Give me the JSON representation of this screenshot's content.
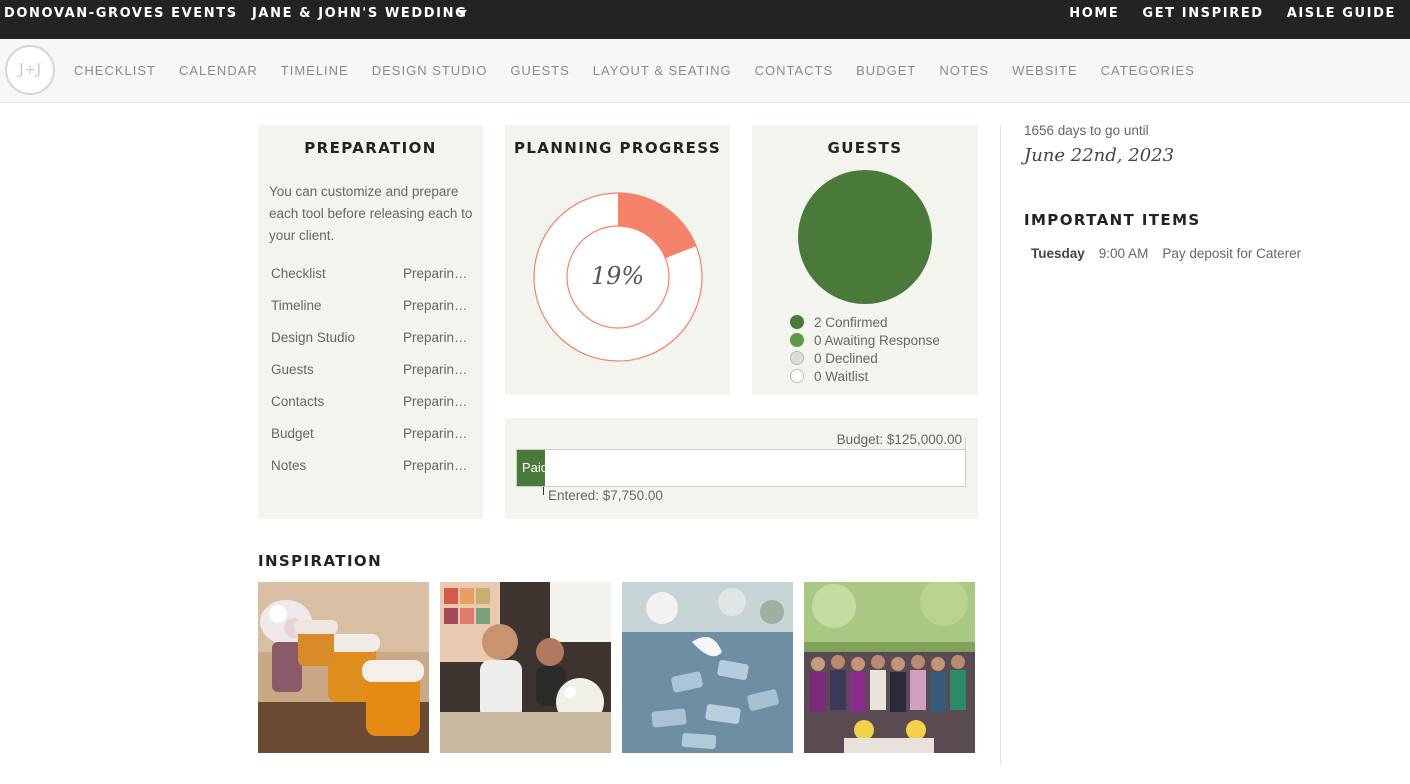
{
  "topbar": {
    "org": "DONOVAN-GROVES EVENTS",
    "separator": ">",
    "event": "JANE & JOHN'S WEDDING",
    "links": [
      "HOME",
      "GET INSPIRED",
      "AISLE GUIDE"
    ]
  },
  "subnav": {
    "avatar_text": "J+J",
    "items": [
      "CHECKLIST",
      "CALENDAR",
      "TIMELINE",
      "DESIGN STUDIO",
      "GUESTS",
      "LAYOUT & SEATING",
      "CONTACTS",
      "BUDGET",
      "NOTES",
      "WEBSITE",
      "CATEGORIES"
    ]
  },
  "preparation": {
    "title": "PREPARATION",
    "description": "You can customize and prepare each tool before releasing each to your client.",
    "tools": [
      {
        "name": "Checklist",
        "status": "Preparing..."
      },
      {
        "name": "Timeline",
        "status": "Preparing..."
      },
      {
        "name": "Design Studio",
        "status": "Preparing..."
      },
      {
        "name": "Guests",
        "status": "Preparing..."
      },
      {
        "name": "Contacts",
        "status": "Preparing..."
      },
      {
        "name": "Budget",
        "status": "Preparing..."
      },
      {
        "name": "Notes",
        "status": "Preparing..."
      }
    ]
  },
  "planning_progress": {
    "title": "PLANNING PROGRESS",
    "percent_label": "19%",
    "percent": 19,
    "accent_color": "#f4836a"
  },
  "guests": {
    "title": "GUESTS",
    "pie_color": "#4a7a3a",
    "legend": [
      {
        "label": "2 Confirmed",
        "color": "#4a7a3a"
      },
      {
        "label": "0 Awaiting Response",
        "color": "#5d9a45"
      },
      {
        "label": "0 Declined",
        "color": "#dcdcdc"
      },
      {
        "label": "0 Waitlist",
        "color": "#ffffff"
      }
    ]
  },
  "budget": {
    "total_label": "Budget: $125,000.00",
    "paid_label": "Paid",
    "entered_label": "Entered: $7,750.00",
    "paid_fraction": 0.062,
    "paid_color": "#4a7a3a"
  },
  "inspiration": {
    "title": "INSPIRATION",
    "photos": [
      "honey-jars-photo",
      "toast-photo",
      "escort-cards-photo",
      "group-photo"
    ]
  },
  "sidebar": {
    "countdown": "1656 days to go until",
    "date": "June 22nd, 2023",
    "important_title": "IMPORTANT ITEMS",
    "items": [
      {
        "day": "Tuesday",
        "time": "9:00 AM",
        "text": "Pay deposit for Caterer"
      }
    ]
  }
}
